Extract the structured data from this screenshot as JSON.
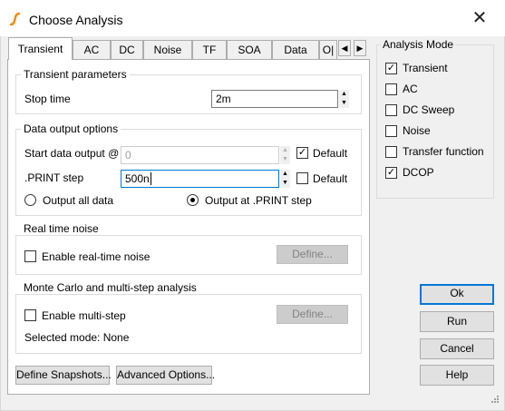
{
  "window": {
    "title": "Choose Analysis"
  },
  "tabs": [
    {
      "label": "Transient",
      "active": true
    },
    {
      "label": "AC",
      "active": false
    },
    {
      "label": "DC",
      "active": false
    },
    {
      "label": "Noise",
      "active": false
    },
    {
      "label": "TF",
      "active": false
    },
    {
      "label": "SOA",
      "active": false
    },
    {
      "label": "Data",
      "active": false
    },
    {
      "label": "O|",
      "active": false
    }
  ],
  "transient_params": {
    "group_label": "Transient parameters",
    "stop_time_label": "Stop time",
    "stop_time_value": "2m"
  },
  "data_output": {
    "group_label": "Data output options",
    "start_label": "Start data output @",
    "start_value": "0",
    "start_default_label": "Default",
    "start_default_checked": true,
    "print_step_label": ".PRINT step",
    "print_step_value": "500n",
    "print_default_label": "Default",
    "print_default_checked": false,
    "radio_all_label": "Output all data",
    "radio_print_label": "Output at .PRINT step",
    "selected_radio": "print"
  },
  "realtime_noise": {
    "group_label": "Real time noise",
    "checkbox_label": "Enable real-time noise",
    "checked": false,
    "define_label": "Define..."
  },
  "monte_carlo": {
    "group_label": "Monte Carlo and multi-step analysis",
    "checkbox_label": "Enable multi-step",
    "checked": false,
    "define_label": "Define...",
    "selected_mode_text": "Selected mode: None"
  },
  "bottom_buttons": {
    "snapshots_label": "Define Snapshots...",
    "advanced_label": "Advanced Options..."
  },
  "analysis_mode": {
    "title": "Analysis Mode",
    "items": [
      {
        "label": "Transient",
        "checked": true
      },
      {
        "label": "AC",
        "checked": false
      },
      {
        "label": "DC Sweep",
        "checked": false
      },
      {
        "label": "Noise",
        "checked": false
      },
      {
        "label": "Transfer function",
        "checked": false
      },
      {
        "label": "DCOP",
        "checked": true
      }
    ]
  },
  "actions": {
    "ok_label": "Ok",
    "run_label": "Run",
    "cancel_label": "Cancel",
    "help_label": "Help"
  },
  "colors": {
    "accent": "#0078d7",
    "logo": "#f08c00"
  },
  "icons": {
    "app": "simetrix-logo-icon",
    "close": "close-icon",
    "tab_left": "chevron-left-icon",
    "tab_right": "chevron-right-icon",
    "check": "checkmark-icon"
  }
}
